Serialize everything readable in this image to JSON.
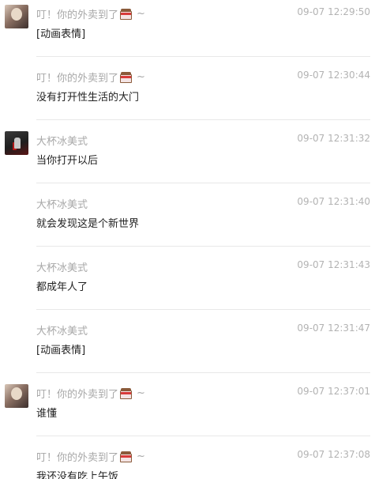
{
  "messages": [
    {
      "sender": "叮！你的外卖到了",
      "badge_icon": "tiffin-box-icon",
      "suffix": "~",
      "time": "09-07 12:29:50",
      "content": "[动画表情]",
      "show_avatar": true,
      "avatar": "user-avatar-girl"
    },
    {
      "sender": "叮！你的外卖到了",
      "badge_icon": "tiffin-box-icon",
      "suffix": "~",
      "time": "09-07 12:30:44",
      "content": "没有打开性生活的大门",
      "show_avatar": false
    },
    {
      "sender": "大杯冰美式",
      "time": "09-07 12:31:32",
      "content": "当你打开以后",
      "show_avatar": true,
      "avatar": "user-avatar-dark"
    },
    {
      "sender": "大杯冰美式",
      "time": "09-07 12:31:40",
      "content": "就会发现这是个新世界",
      "show_avatar": false
    },
    {
      "sender": "大杯冰美式",
      "time": "09-07 12:31:43",
      "content": "都成年人了",
      "show_avatar": false
    },
    {
      "sender": "大杯冰美式",
      "time": "09-07 12:31:47",
      "content": "[动画表情]",
      "show_avatar": false
    },
    {
      "sender": "叮！你的外卖到了",
      "badge_icon": "tiffin-box-icon",
      "suffix": "~",
      "time": "09-07 12:37:01",
      "content": "谁懂",
      "show_avatar": true,
      "avatar": "user-avatar-girl"
    },
    {
      "sender": "叮！你的外卖到了",
      "badge_icon": "tiffin-box-icon",
      "suffix": "~",
      "time": "09-07 12:37:08",
      "content": "我还没有吃上午饭",
      "show_avatar": false
    }
  ]
}
